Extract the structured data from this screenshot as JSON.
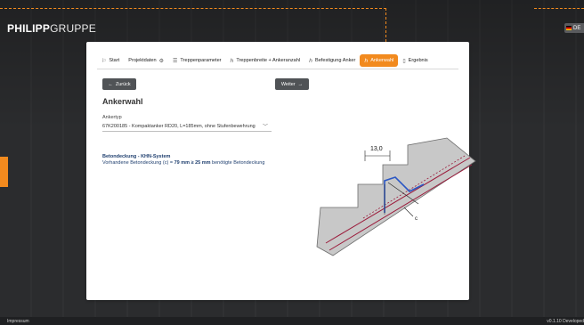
{
  "header": {
    "logo_bold": "PHILIPP",
    "logo_light": "GRUPPE",
    "language": "DE"
  },
  "tabs": [
    {
      "icon": "flag-icon",
      "label": "Start"
    },
    {
      "icon": "",
      "label": "Projektdaten",
      "suffix": "⚙"
    },
    {
      "icon": "list-icon",
      "label": "Treppenparameter"
    },
    {
      "icon": "anchor-icon",
      "label": "Treppenbreite + Ankeranzahl"
    },
    {
      "icon": "anchor-icon",
      "label": "Befestigung Anker"
    },
    {
      "icon": "anchor-icon",
      "label": "Ankerwahl",
      "active": true
    },
    {
      "icon": "document-icon",
      "label": "Ergebnis"
    }
  ],
  "buttons": {
    "back": "Zurück",
    "next": "Weiter"
  },
  "page": {
    "title": "Ankerwahl",
    "anchor_type_label": "Ankertyp",
    "anchor_type_value": "67K200185 - Kompaktanker RD20, L=185mm, ohne Stufenbewehrung"
  },
  "concrete": {
    "title": "Betondeckung - KHN-System",
    "text_prefix": "Vorhandene Betondeckung (c) = ",
    "value_present": "79 mm",
    "text_mid": " ≥ ",
    "value_required": "25 mm",
    "text_suffix": " benötigte Betondeckung"
  },
  "diagram": {
    "dimension_label": "13,0",
    "c_label": "c"
  },
  "footer": {
    "impressum": "Impressum",
    "version": "v0.1.10  Developed"
  },
  "colors": {
    "accent": "#f28a1e",
    "button": "#505356",
    "text_blue": "#1e3e6e"
  }
}
